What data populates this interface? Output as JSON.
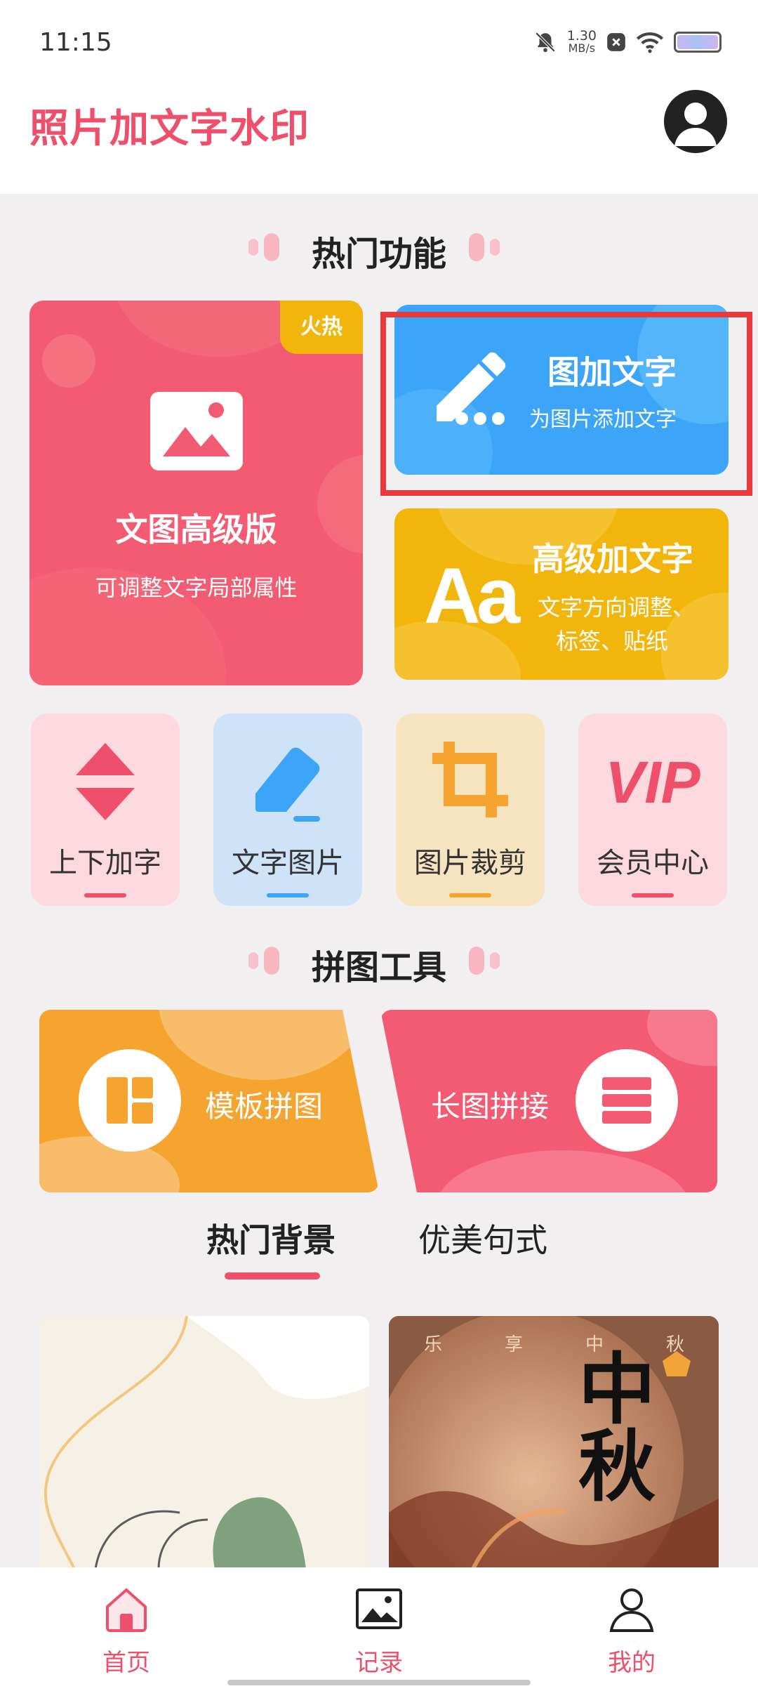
{
  "status_bar": {
    "time": "11:15",
    "net_speed_value": "1.30",
    "net_speed_unit": "MB/s"
  },
  "header": {
    "title": "照片加文字水印"
  },
  "icons": {
    "bell_off": "bell-off-icon",
    "close_small": "close-small-icon",
    "wifi": "wifi-icon",
    "battery": "battery-icon",
    "avatar": "user-avatar-icon",
    "image": "image-icon",
    "pen": "pen-icon",
    "font": "font-aa-icon",
    "updown": "up-down-arrows-icon",
    "eraser": "eraser-icon",
    "crop": "crop-icon",
    "vip": "vip-icon",
    "grid": "grid-layout-icon",
    "rows": "rows-stack-icon",
    "home": "home-icon",
    "picture": "picture-icon",
    "user": "user-icon"
  },
  "hot_section": {
    "title": "热门功能"
  },
  "cards": {
    "advanced": {
      "tag": "火热",
      "title": "文图高级版",
      "subtitle": "可调整文字局部属性"
    },
    "add_text": {
      "title": "图加文字",
      "subtitle": "为图片添加文字"
    },
    "pro_text": {
      "title": "高级加文字",
      "subtitle_line1": "文字方向调整、",
      "subtitle_line2": "标签、贴纸",
      "glyph": "Aa"
    }
  },
  "tiles": [
    {
      "label": "上下加字",
      "accent": "#ee4f6a"
    },
    {
      "label": "文字图片",
      "accent": "#3da5f8"
    },
    {
      "label": "图片裁剪",
      "accent": "#f5a42f"
    },
    {
      "label": "会员中心",
      "accent": "#ee4f6a",
      "glyph": "VIP"
    }
  ],
  "puzzle_section": {
    "title": "拼图工具"
  },
  "puzzle": {
    "template": "模板拼图",
    "long": "长图拼接"
  },
  "tabs": {
    "hot_bg": "热门背景",
    "quotes": "优美句式"
  },
  "gallery": {
    "bg2_chars": [
      "乐",
      "享",
      "中",
      "秋"
    ],
    "bg2_calligraphy": "中秋"
  },
  "nav": {
    "home": "首页",
    "records": "记录",
    "mine": "我的"
  },
  "colors": {
    "brand": "#ee4f6a",
    "blue": "#3da5f8",
    "yellow": "#f2b50c",
    "orange": "#f5a42f",
    "highlight": "#e8393d"
  }
}
